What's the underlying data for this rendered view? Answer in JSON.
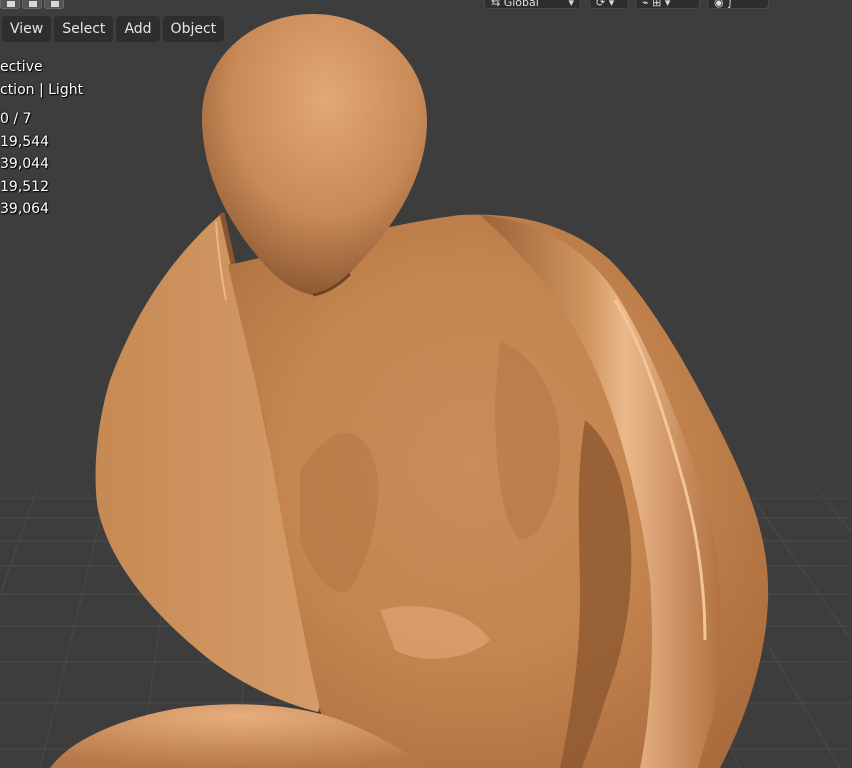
{
  "header": {
    "menu": [
      "View",
      "Select",
      "Add",
      "Object"
    ],
    "transform_orientation": "Global",
    "icons": [
      "select-mode-icon",
      "transform-orientation-icon",
      "pivot-point-icon",
      "snap-icon",
      "proportional-editing-icon"
    ]
  },
  "overlay": {
    "view_name": "ective",
    "collection": "ction | Light",
    "stats": [
      "0 / 7",
      "19,544",
      "39,044",
      "19,512",
      "39,064"
    ]
  },
  "colors": {
    "viewport_bg": "#3d3d3d",
    "grid_line": "#4a4a4a",
    "clay_mid": "#c98a58",
    "clay_light": "#e3a878",
    "clay_dark": "#9a6238",
    "header_button": "#2e2e2e"
  }
}
